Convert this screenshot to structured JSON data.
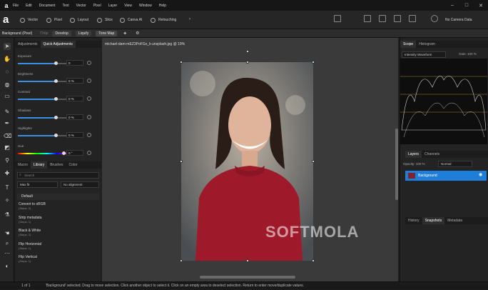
{
  "menu": [
    "File",
    "Edit",
    "Document",
    "Text",
    "Vector",
    "Pixel",
    "Layer",
    "View",
    "Window",
    "Help"
  ],
  "personas": [
    "Vector",
    "Pixel",
    "Layout",
    "Slice",
    "Canva AI",
    "Retouching"
  ],
  "camera": "No Camera Data",
  "context": {
    "layer": "Background (Pixel)",
    "dpi": "72dpi",
    "buttons": [
      "Develop",
      "Liquify",
      "Tone Map"
    ]
  },
  "left_tabs": [
    "Adjustments",
    "Quick Adjustments"
  ],
  "adjustments": [
    {
      "label": "Exposure",
      "value": "0",
      "level": 0.65
    },
    {
      "label": "Brightness",
      "value": "0 %",
      "level": 0.65
    },
    {
      "label": "Contrast",
      "value": "0 %",
      "level": 0.65
    },
    {
      "label": "Shadows",
      "value": "0 %",
      "level": 0.65
    },
    {
      "label": "Highlights",
      "value": "0 %",
      "level": 0.65
    },
    {
      "label": "Hue",
      "value": "0 °",
      "level": 0.78
    }
  ],
  "macro_tabs": [
    "Macro",
    "Library",
    "Brushes",
    "Color"
  ],
  "search_placeholder": "Search",
  "max_fit": "Max fit",
  "alignment": "No alignment",
  "default_group": "Default",
  "macros": [
    {
      "name": "Convert to sRGB",
      "steps": "(Steps: 2)"
    },
    {
      "name": "Strip metadata",
      "steps": "(Steps: 1)"
    },
    {
      "name": "Black & White",
      "steps": "(Steps: 2)"
    },
    {
      "name": "Flip Horizontal",
      "steps": "(Steps: 1)"
    },
    {
      "name": "Flip Vertical",
      "steps": "(Steps: 1)"
    }
  ],
  "doc_tab": "michael-dam-mEZ3PoFGs_k-unsplash.jpg @ 19%",
  "scope": {
    "tabs": [
      "Scope",
      "Histogram"
    ],
    "mode": "Intensity Waveform",
    "gain": "Gain: 100 %"
  },
  "layers": {
    "tabs": [
      "Layers",
      "Channels"
    ],
    "opacity": "Opacity: 100 %",
    "blend": "Normal",
    "item": "Background"
  },
  "history_tabs": [
    "History",
    "Snapshots",
    "Metadata"
  ],
  "status": {
    "page": "1 of 1",
    "message": "'Background' selected. Drag to move selection. Click another object to select it. Click on an empty area to deselect selection. Return to enter move/duplicate values."
  },
  "watermark": "SOFTMOLA"
}
